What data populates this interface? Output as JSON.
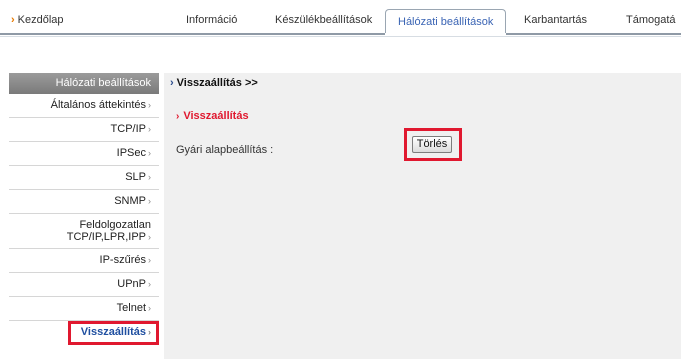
{
  "nav": {
    "home": "Kezdőlap",
    "tabs": [
      {
        "label": "Információ"
      },
      {
        "label": "Készülékbeállítások"
      },
      {
        "label": "Hálózati beállítások",
        "active": true
      },
      {
        "label": "Karbantartás"
      },
      {
        "label": "Támogatá"
      }
    ]
  },
  "sidebar": {
    "header": "Hálózati beállítások",
    "items": [
      {
        "label": "Általános áttekintés"
      },
      {
        "label": "TCP/IP"
      },
      {
        "label": "IPSec"
      },
      {
        "label": "SLP"
      },
      {
        "label": "SNMP"
      },
      {
        "label_line1": "Feldolgozatlan",
        "label_line2": "TCP/IP,LPR,IPP"
      },
      {
        "label": "IP-szűrés"
      },
      {
        "label": "UPnP"
      },
      {
        "label": "Telnet"
      },
      {
        "label": "Visszaállítás",
        "active": true
      }
    ],
    "chevron": "›"
  },
  "main": {
    "breadcrumb": "Visszaállítás >>",
    "section_title": "Visszaállítás",
    "factory_label": "Gyári alapbeállítás :",
    "delete_button": "Törlés"
  },
  "colors": {
    "accent_red": "#e0182f",
    "link_blue": "#3a64b4",
    "home_arrow": "#e87a00",
    "sidebar_header": "#8a8a8a",
    "content_bg": "#f0f0f0"
  },
  "icons": {
    "home_arrow": "arrow-right-icon",
    "breadcrumb_caret": "chevron-right-icon",
    "section_caret": "chevron-right-icon"
  }
}
